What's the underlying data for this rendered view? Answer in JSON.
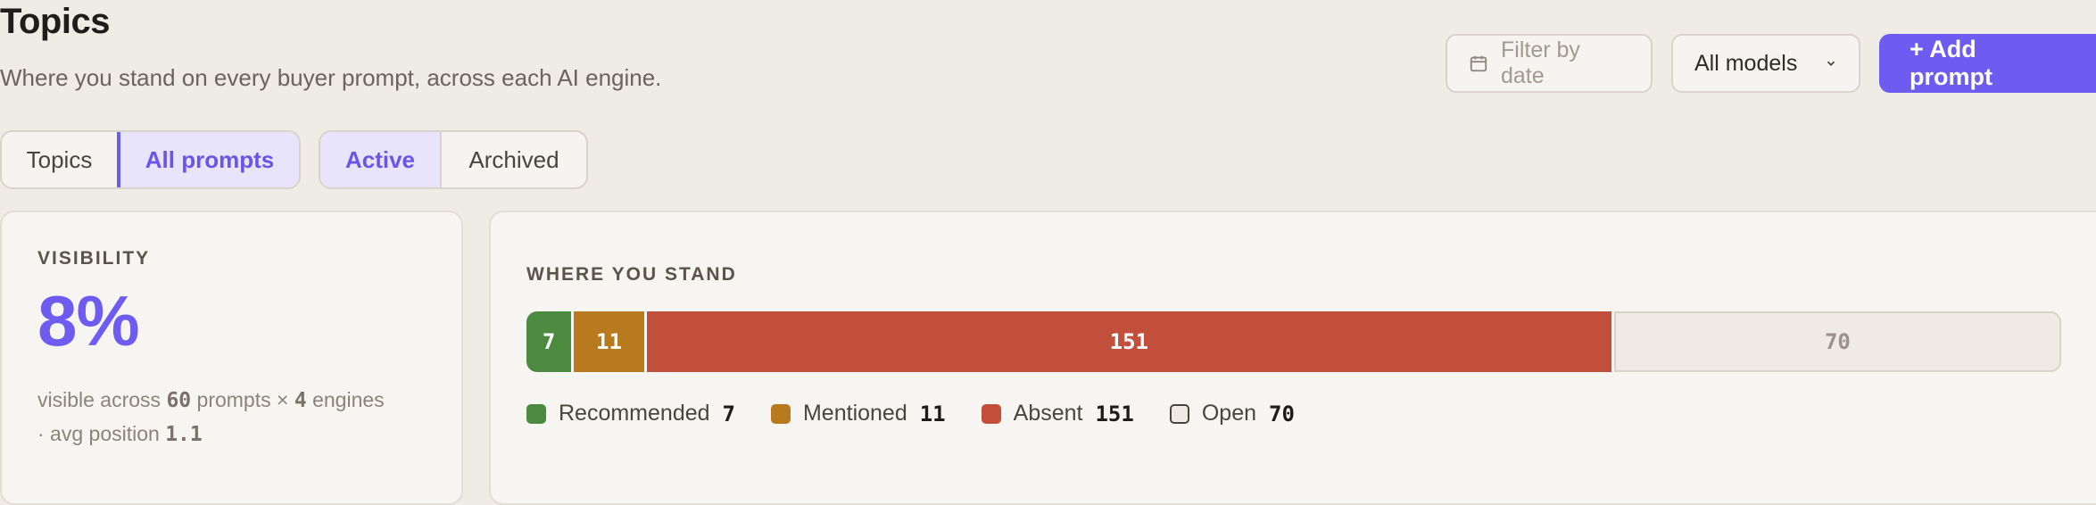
{
  "header": {
    "title": "Topics",
    "subtitle": "Where you stand on every buyer prompt, across each AI engine."
  },
  "toolbar": {
    "filter_placeholder": "Filter by date",
    "models_label": "All models",
    "add_label": "+ Add prompt"
  },
  "view_toggle": {
    "options": [
      "Topics",
      "All prompts"
    ],
    "selected": "All prompts"
  },
  "status_toggle": {
    "options": [
      "Active",
      "Archived"
    ],
    "selected": "Active"
  },
  "visibility": {
    "label": "VISIBILITY",
    "value": "8%",
    "note_prefix": "visible across",
    "prompts": "60",
    "note_mid": "prompts ×",
    "engines": "4",
    "note_engines": "engines",
    "note_avg": "· avg position",
    "avg_position": "1.1"
  },
  "where_you_stand": {
    "label": "WHERE YOU STAND",
    "segments": [
      {
        "name": "Recommended",
        "count": 7,
        "color": "#4c8a3f"
      },
      {
        "name": "Mentioned",
        "count": 11,
        "color": "#b77a1e"
      },
      {
        "name": "Absent",
        "count": 151,
        "color": "#c24e3c"
      },
      {
        "name": "Open",
        "count": 70,
        "color": "#efebe4"
      }
    ]
  }
}
